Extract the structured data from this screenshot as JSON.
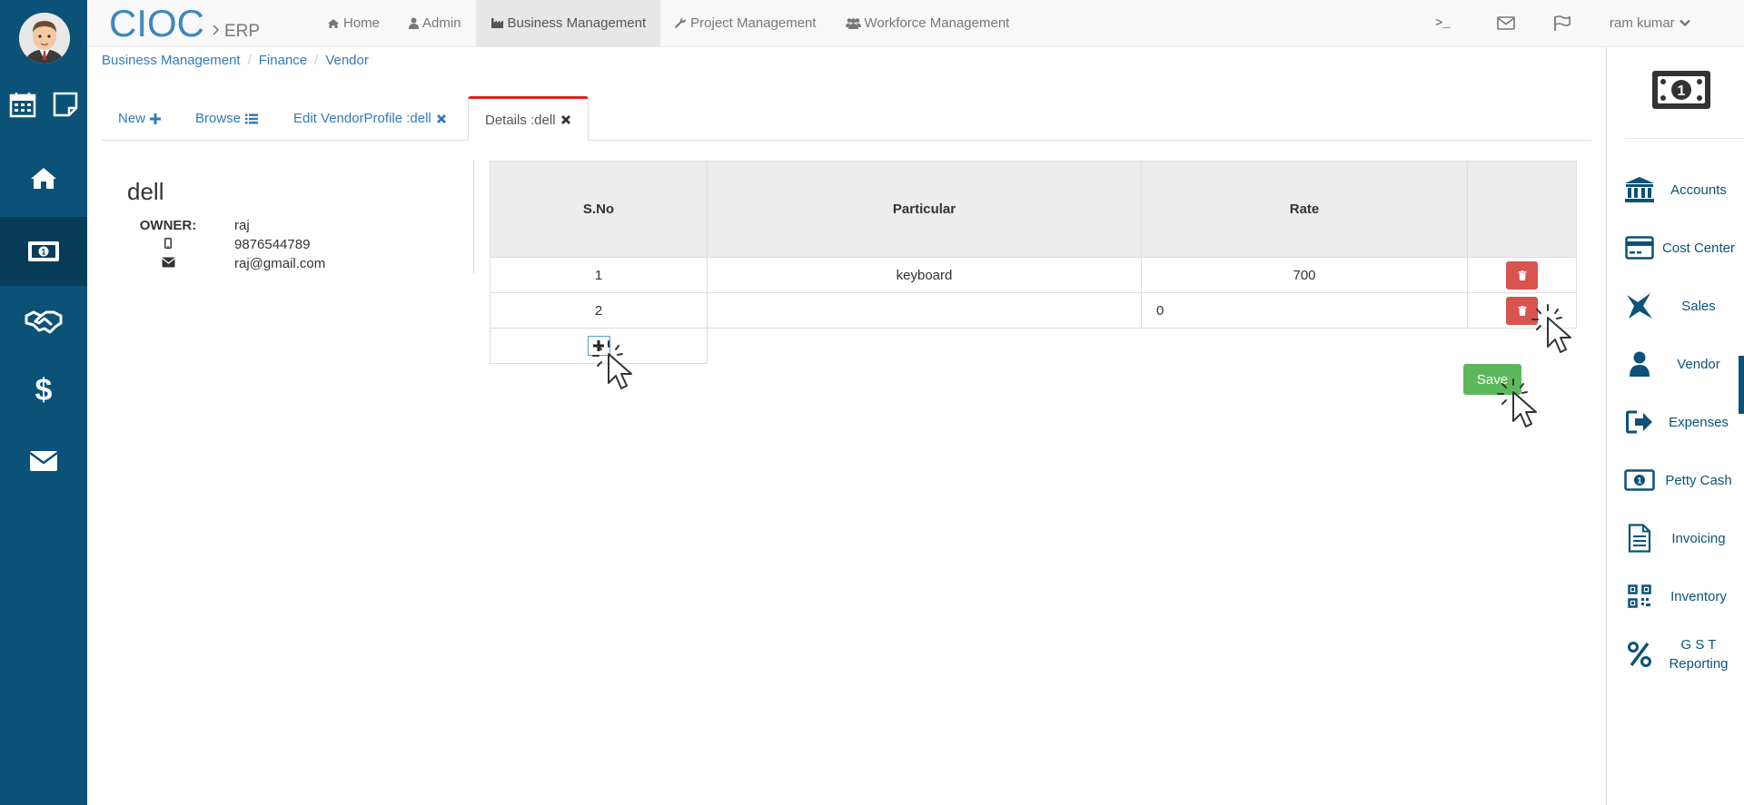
{
  "brand": {
    "main": "CIOC",
    "sub": "ERP"
  },
  "nav": {
    "links": [
      "Home",
      "Admin",
      "Business Management",
      "Project Management",
      "Workforce Management"
    ],
    "terminal_label": ">_",
    "user": "ram kumar"
  },
  "breadcrumb": [
    "Business Management",
    "Finance",
    "Vendor"
  ],
  "tabs": [
    "New",
    "Browse",
    "Edit VendorProfile :dell",
    "Details :dell"
  ],
  "vendor": {
    "name": "dell",
    "owner_label": "OWNER:",
    "owner": "raj",
    "phone": "9876544789",
    "email": "raj@gmail.com"
  },
  "table": {
    "headers": [
      "S.No",
      "Particular",
      "Rate",
      ""
    ],
    "rows": [
      {
        "sno": "1",
        "particular": "keyboard",
        "rate": "700"
      },
      {
        "sno": "2",
        "particular": "",
        "rate": "0"
      }
    ]
  },
  "save_label": "Save",
  "right_menu": [
    "Accounts",
    "Cost Center",
    "Sales",
    "Vendor",
    "Expenses",
    "Petty Cash",
    "Invoicing",
    "Inventory",
    "G S T Reporting"
  ],
  "colors": {
    "sidebar": "#0a5277",
    "link": "#337ab7",
    "danger": "#d9534f",
    "success": "#5cb85c",
    "active_tab_top": "#e02020"
  }
}
